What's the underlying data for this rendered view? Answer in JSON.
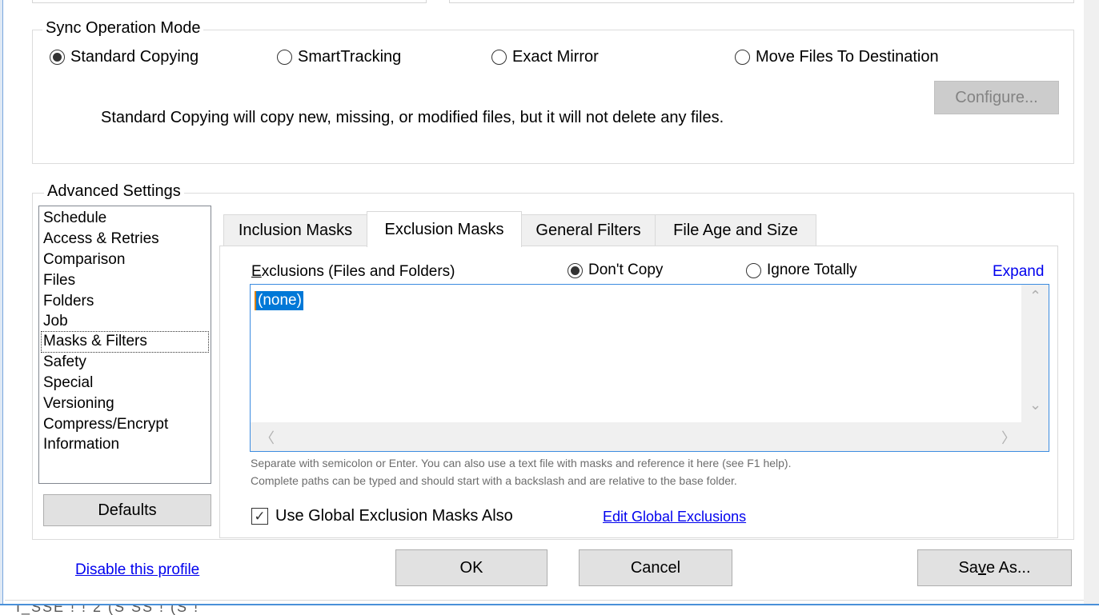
{
  "sync_mode": {
    "title": "Sync Operation Mode",
    "options": [
      {
        "label": "Standard Copying",
        "selected": true
      },
      {
        "label": "SmartTracking",
        "selected": false
      },
      {
        "label": "Exact Mirror",
        "selected": false
      },
      {
        "label": "Move Files To Destination",
        "selected": false
      }
    ],
    "configure_label": "Configure...",
    "description": "Standard Copying will copy new, missing, or modified files, but it will not delete any files."
  },
  "advanced": {
    "title": "Advanced Settings",
    "categories": [
      "Schedule",
      "Access & Retries",
      "Comparison",
      "Files",
      "Folders",
      "Job",
      "Masks & Filters",
      "Safety",
      "Special",
      "Versioning",
      "Compress/Encrypt",
      "Information"
    ],
    "selected_category": "Masks & Filters",
    "defaults_label": "Defaults",
    "tabs": [
      {
        "label": "Inclusion Masks",
        "active": false
      },
      {
        "label": "Exclusion Masks",
        "active": true
      },
      {
        "label": "General Filters",
        "active": false
      },
      {
        "label": "File Age and Size",
        "active": false
      }
    ],
    "exclusions_label": "Exclusions (Files and Folders)",
    "exclusion_mode": [
      {
        "label": "Don't Copy",
        "selected": true
      },
      {
        "label": "Ignore Totally",
        "selected": false
      }
    ],
    "expand_link": "Expand",
    "mask_value": "(none)",
    "hint_line1": "Separate with semicolon or Enter.  You can also use a text file with masks and reference it here (see F1 help).",
    "hint_line2": "Complete paths can be typed and should start with a backslash and are relative to the base folder.",
    "global_checkbox_label": "Use Global Exclusion Masks Also",
    "global_checkbox_checked": true,
    "edit_global_link": "Edit Global Exclusions"
  },
  "footer": {
    "disable_link": "Disable this profile",
    "ok_label": "OK",
    "cancel_label": "Cancel",
    "save_as_label": "Save As..."
  },
  "background_text": "I_SSE ! ! 2 (S  SS  ! (S  !"
}
